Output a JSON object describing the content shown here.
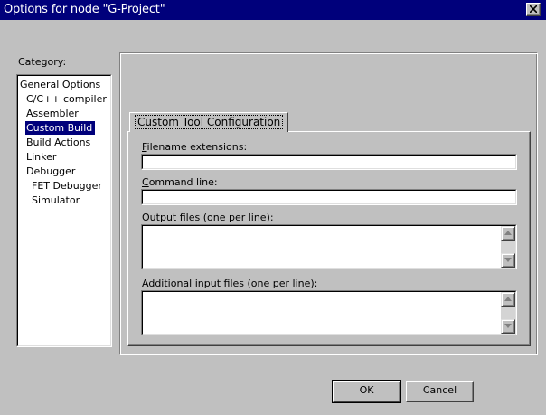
{
  "window": {
    "title": "Options for node \"G-Project\"",
    "close_icon": "close-icon"
  },
  "category": {
    "label": "Category:",
    "items": [
      {
        "label": "General Options",
        "indent": 0,
        "selected": false
      },
      {
        "label": "C/C++ compiler",
        "indent": 1,
        "selected": false
      },
      {
        "label": "Assembler",
        "indent": 1,
        "selected": false
      },
      {
        "label": "Custom Build",
        "indent": 1,
        "selected": true
      },
      {
        "label": "Build Actions",
        "indent": 1,
        "selected": false
      },
      {
        "label": "Linker",
        "indent": 1,
        "selected": false
      },
      {
        "label": "Debugger",
        "indent": 1,
        "selected": false
      },
      {
        "label": "FET Debugger",
        "indent": 2,
        "selected": false
      },
      {
        "label": "Simulator",
        "indent": 2,
        "selected": false
      }
    ]
  },
  "tab": {
    "label": "Custom Tool Configuration"
  },
  "fields": {
    "filename_ext": {
      "accel": "F",
      "rest": "ilename extensions:",
      "value": ""
    },
    "command_line": {
      "accel": "C",
      "rest": "ommand line:",
      "value": ""
    },
    "output_files": {
      "accel": "O",
      "rest": "utput files (one per line):",
      "value": ""
    },
    "input_files": {
      "accel": "A",
      "rest": "dditional input files (one per line):",
      "value": ""
    }
  },
  "buttons": {
    "ok": "OK",
    "cancel": "Cancel"
  }
}
